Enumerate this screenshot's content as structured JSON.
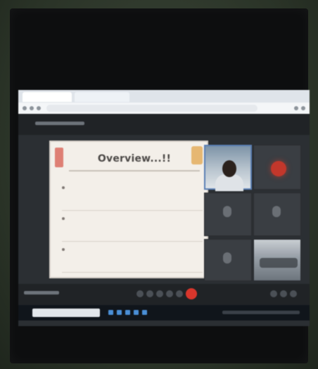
{
  "slide": {
    "title": "Overview...!!",
    "bullets": [
      "",
      "",
      ""
    ]
  },
  "participants": [
    {
      "label": ""
    },
    {
      "label": ""
    },
    {
      "label": ""
    },
    {
      "label": ""
    },
    {
      "label": ""
    },
    {
      "label": ""
    }
  ],
  "colors": {
    "leave_button": "#d9362c",
    "active_speaker_border": "#5a7fb4",
    "avatar_red": "#c2372b"
  },
  "icons": [
    "leave-call-icon",
    "mic-icon",
    "camera-icon",
    "share-screen-icon",
    "more-options-icon",
    "search-icon"
  ]
}
